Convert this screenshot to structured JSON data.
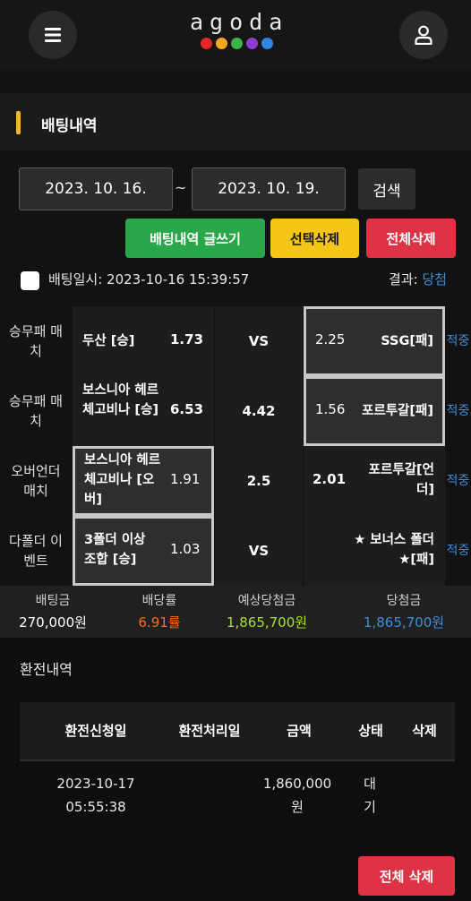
{
  "header": {
    "logo": "agoda",
    "logo_dots": [
      "#e02828",
      "#f6a623",
      "#3bb54a",
      "#8e3ccf",
      "#2f86e6"
    ],
    "menu_icon": "hamburger-menu-icon",
    "user_icon": "user-icon"
  },
  "section": {
    "title": "배팅내역"
  },
  "filter": {
    "date_from": "2023. 10. 16.",
    "separator": "~",
    "date_to": "2023. 10. 19.",
    "search_label": "검색"
  },
  "actions": {
    "write_label": "배팅내역 글쓰기",
    "delete_selected_label": "선택삭제",
    "delete_all_label": "전체삭제"
  },
  "colors": {
    "green": "#29a84a",
    "yellow": "#f5c518",
    "red": "#dd3344",
    "blue": "#3b8ede",
    "orange": "#ff6a1a",
    "lime": "#a8e02a"
  },
  "bet": {
    "date_label": "배팅일시: 2023-10-16 15:39:57",
    "result_label": "결과:",
    "result_value": "당첨",
    "rows": [
      {
        "type": "승무패 매치",
        "home": "두산 [승]",
        "home_odds": "1.73",
        "draw": "VS",
        "away_odds": "2.25",
        "away": "SSG[패]",
        "result": "적중"
      },
      {
        "type": "승무패 매치",
        "home": "보스니아 헤르체고비나 [승]",
        "home_odds": "6.53",
        "draw": "4.42",
        "away_odds": "1.56",
        "away": "포르투갈[패]",
        "result": "적중"
      },
      {
        "type": "오버언더 매치",
        "home": "보스니아 헤르체고비나 [오버]",
        "home_odds": "1.91",
        "draw": "2.5",
        "away_odds": "2.01",
        "away": "포르투갈[언더]",
        "result": "적중"
      },
      {
        "type": "다폴더 이벤트",
        "home": "3폴더 이상 조합 [승]",
        "home_odds": "1.03",
        "draw": "VS",
        "away_odds": "",
        "away": "★ 보너스 폴더 ★[패]",
        "result": "적중"
      }
    ]
  },
  "summary": {
    "stake_label": "배팅금",
    "stake_value": "270,000원",
    "odds_label": "배당률",
    "odds_value": "6.91률",
    "expected_label": "예상당첨금",
    "expected_value": "1,865,700원",
    "win_label": "당첨금",
    "win_value": "1,865,700원"
  },
  "exchange": {
    "title": "환전내역",
    "headers": [
      "환전신청일",
      "환전처리일",
      "금액",
      "상태",
      "삭제"
    ],
    "row": {
      "date_line1": "2023-10-17",
      "date_line2": "05:55:38",
      "processed": "",
      "amount_line1": "1,860,000",
      "amount_line2": "원",
      "status_line1": "대",
      "status_line2": "기"
    },
    "delete_all_label": "전체 삭제"
  }
}
